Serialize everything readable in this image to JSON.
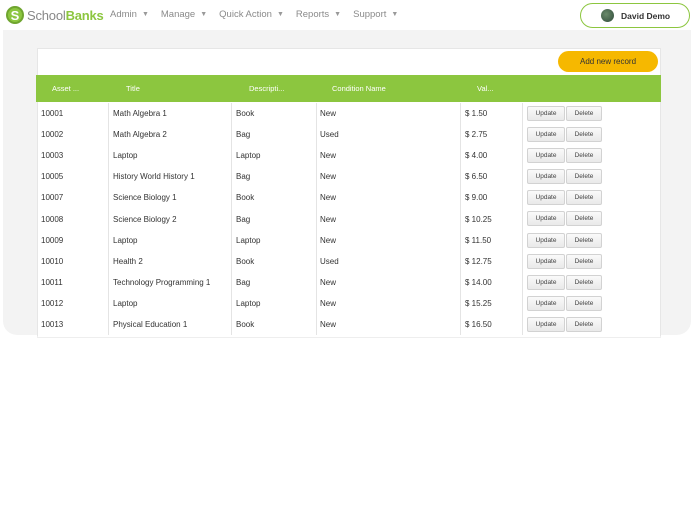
{
  "brand": {
    "logo_letter": "S",
    "name_part1": "School",
    "name_part2": "Banks",
    "accent": "#8cc63f"
  },
  "nav": [
    {
      "label": "Admin"
    },
    {
      "label": "Manage"
    },
    {
      "label": "Quick Action"
    },
    {
      "label": "Reports"
    },
    {
      "label": "Support"
    }
  ],
  "user": {
    "name": "David Demo"
  },
  "toolbar": {
    "add_label": "Add new record"
  },
  "table": {
    "columns": [
      "Asset ...",
      "Title",
      "Descripti...",
      "Condition Name",
      "Val..."
    ],
    "update_label": "Update",
    "delete_label": "Delete",
    "rows": [
      {
        "asset": "10001",
        "title": "Math Algebra 1",
        "desc": "Book",
        "cond": "New",
        "value": "$ 1.50"
      },
      {
        "asset": "10002",
        "title": "Math Algebra 2",
        "desc": "Bag",
        "cond": "Used",
        "value": "$ 2.75"
      },
      {
        "asset": "10003",
        "title": "Laptop",
        "desc": "Laptop",
        "cond": "New",
        "value": "$ 4.00"
      },
      {
        "asset": "10005",
        "title": "History World History 1",
        "desc": "Bag",
        "cond": "New",
        "value": "$ 6.50"
      },
      {
        "asset": "10007",
        "title": "Science Biology 1",
        "desc": "Book",
        "cond": "New",
        "value": "$ 9.00"
      },
      {
        "asset": "10008",
        "title": "Science Biology 2",
        "desc": "Bag",
        "cond": "New",
        "value": "$ 10.25"
      },
      {
        "asset": "10009",
        "title": "Laptop",
        "desc": "Laptop",
        "cond": "New",
        "value": "$ 11.50"
      },
      {
        "asset": "10010",
        "title": "Health 2",
        "desc": "Book",
        "cond": "Used",
        "value": "$ 12.75"
      },
      {
        "asset": "10011",
        "title": "Technology Programming 1",
        "desc": "Bag",
        "cond": "New",
        "value": "$ 14.00"
      },
      {
        "asset": "10012",
        "title": "Laptop",
        "desc": "Laptop",
        "cond": "New",
        "value": "$ 15.25"
      },
      {
        "asset": "10013",
        "title": "Physical Education 1",
        "desc": "Book",
        "cond": "New",
        "value": "$ 16.50"
      }
    ]
  }
}
